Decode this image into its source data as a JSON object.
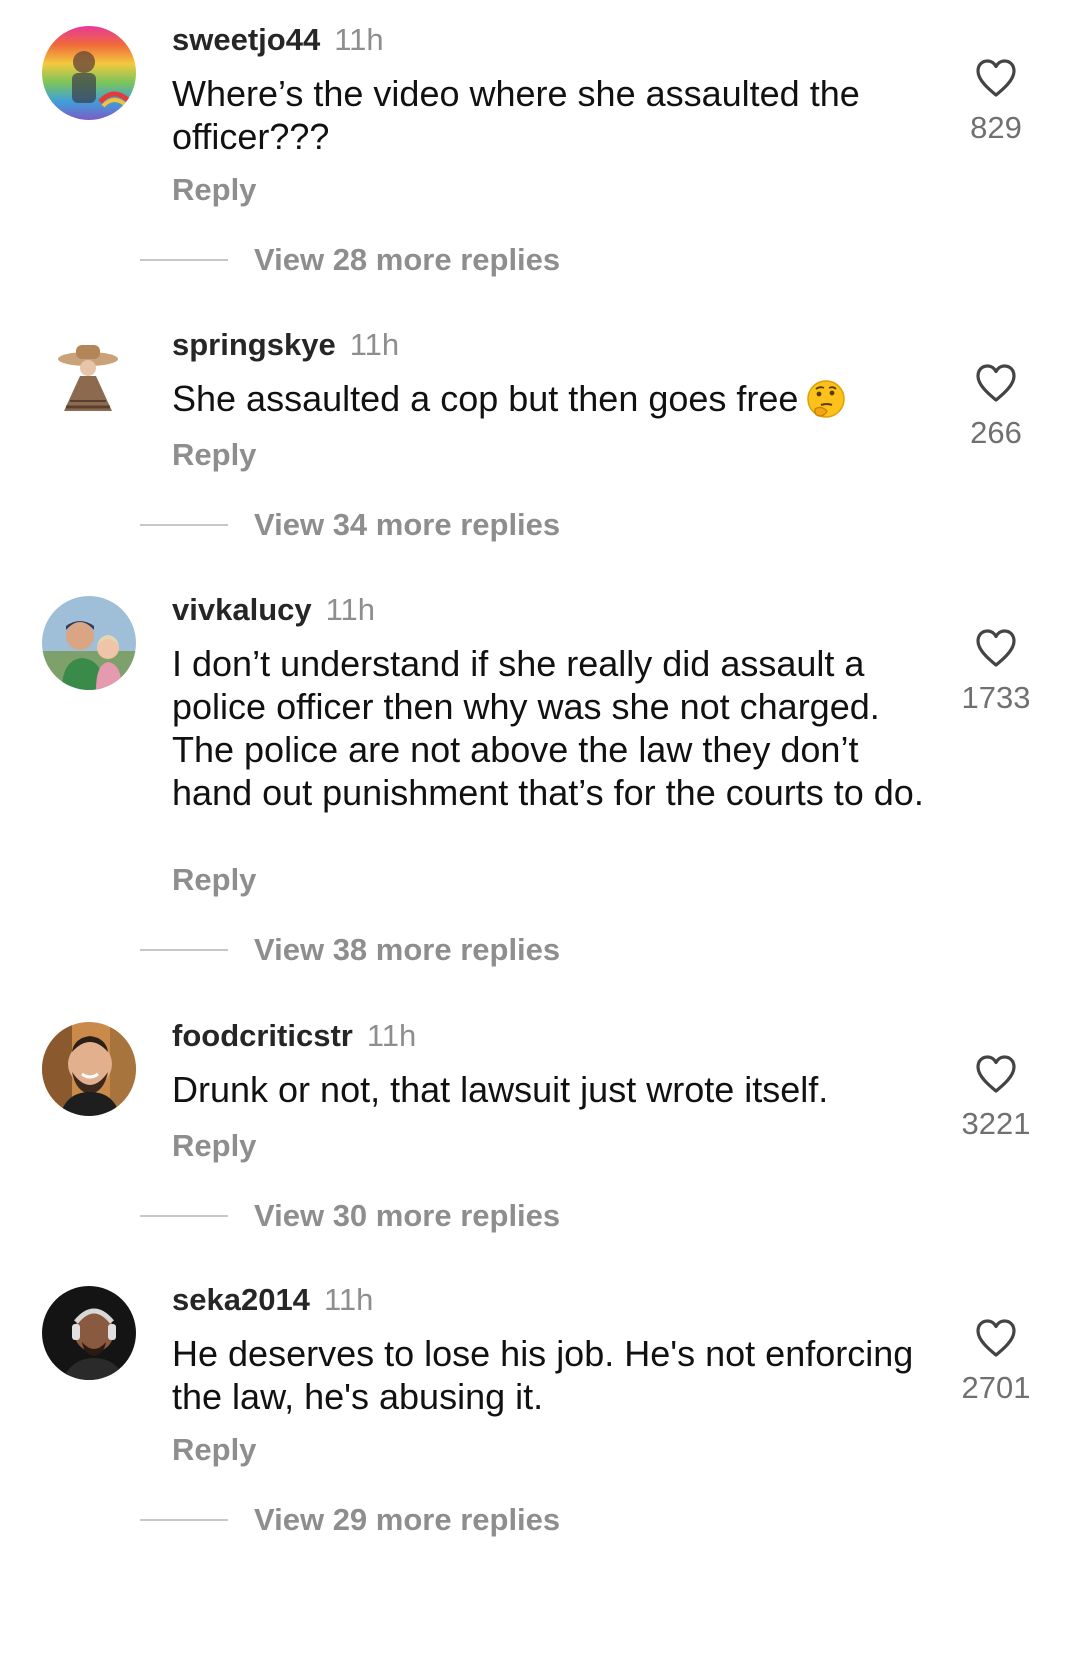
{
  "comments": [
    {
      "username": "sweetjo44",
      "time": "11h",
      "text": "Where’s the video where she assaulted the officer???",
      "likes": "829",
      "reply_label": "Reply",
      "view_replies": "View 28 more replies",
      "avatar_icon": "rainbow-profile-photo"
    },
    {
      "username": "springskye",
      "time": "11h",
      "text": "She assaulted a cop but then goes free",
      "emoji": "thinking-face-icon",
      "likes": "266",
      "reply_label": "Reply",
      "view_replies": "View 34 more replies",
      "avatar_icon": "woman-in-sun-hat-drawing"
    },
    {
      "username": "vivkalucy",
      "time": "11h",
      "text": "I don’t understand if she really did assault a police officer then why was she not charged. The police are not above the law they don’t hand out punishment that’s for the courts to do.",
      "likes": "1733",
      "reply_label": "Reply",
      "view_replies": "View 38 more replies",
      "avatar_icon": "man-and-child-photo"
    },
    {
      "username": "foodcriticstr",
      "time": "11h",
      "text": "Drunk or not, that lawsuit just wrote itself.",
      "likes": "3221",
      "reply_label": "Reply",
      "view_replies": "View 30 more replies",
      "avatar_icon": "smiling-bearded-man-photo"
    },
    {
      "username": "seka2014",
      "time": "11h",
      "text": "He deserves to lose his job. He's not enforcing the law, he's abusing it.",
      "likes": "2701",
      "reply_label": "Reply",
      "view_replies": "View 29 more replies",
      "avatar_icon": "man-with-headphones-photo"
    }
  ],
  "colors": {
    "text": "#111111",
    "username": "#262626",
    "secondary": "#8e8e8e",
    "divider": "#c7c7c7"
  }
}
